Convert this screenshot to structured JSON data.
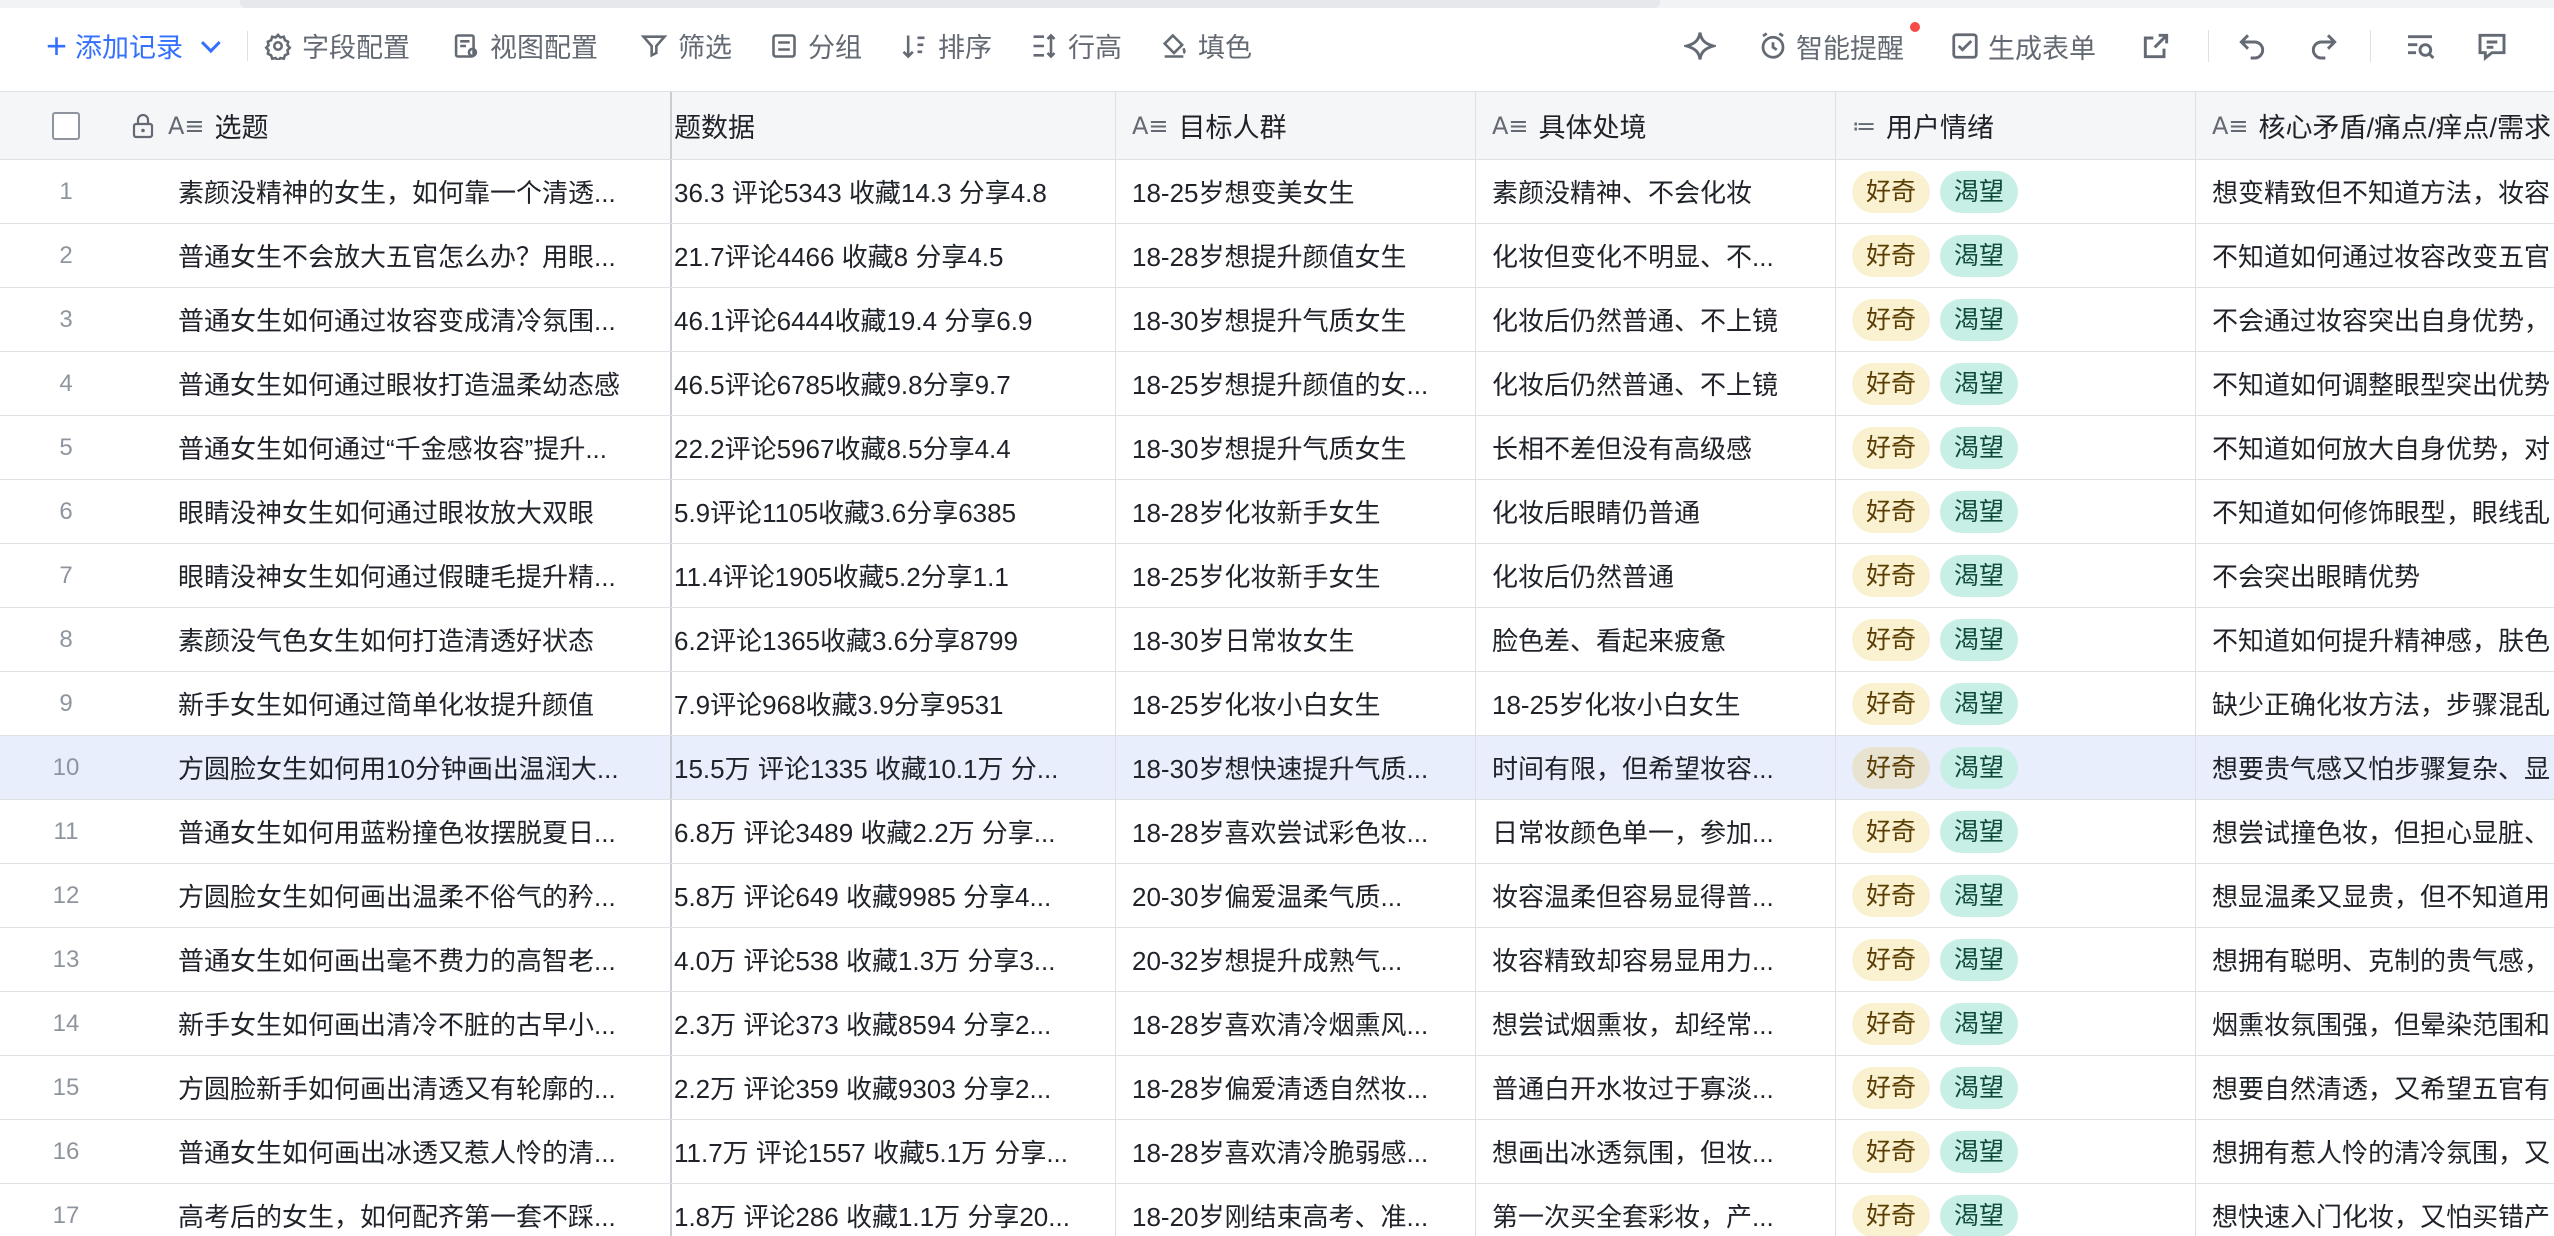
{
  "toolbar": {
    "add_label": "添加记录",
    "items": [
      {
        "label": "字段配置",
        "icon": "gear-icon"
      },
      {
        "label": "视图配置",
        "icon": "view-config-icon"
      },
      {
        "label": "筛选",
        "icon": "filter-icon"
      },
      {
        "label": "分组",
        "icon": "group-icon"
      },
      {
        "label": "排序",
        "icon": "sort-icon"
      },
      {
        "label": "行高",
        "icon": "row-height-icon"
      },
      {
        "label": "填色",
        "icon": "fill-color-icon"
      }
    ],
    "smart_remind_label": "智能提醒",
    "generate_form_label": "生成表单"
  },
  "columns": {
    "title": "选题",
    "data": "题数据",
    "audience": "目标人群",
    "situation": "具体处境",
    "emotion": "用户情绪",
    "core": "核心矛盾/痛点/痒点/需求"
  },
  "emotion_tags": [
    "好奇",
    "渴望"
  ],
  "selected_row": 10,
  "rows": [
    {
      "n": "1",
      "title": "素颜没精神的女生，如何靠一个清透...",
      "data": "36.3 评论5343 收藏14.3 分享4.8",
      "audience": "18-25岁想变美女生",
      "situation": "素颜没精神、不会化妆",
      "core": "想变精致但不知道方法，妆容"
    },
    {
      "n": "2",
      "title": "普通女生不会放大五官怎么办？用眼...",
      "data": "21.7评论4466 收藏8 分享4.5",
      "audience": "18-28岁想提升颜值女生",
      "situation": "化妆但变化不明显、不...",
      "core": "不知道如何通过妆容改变五官"
    },
    {
      "n": "3",
      "title": "普通女生如何通过妆容变成清冷氛围...",
      "data": "46.1评论6444收藏19.4 分享6.9",
      "audience": "18-30岁想提升气质女生",
      "situation": "化妆后仍然普通、不上镜",
      "core": "不会通过妆容突出自身优势，"
    },
    {
      "n": "4",
      "title": "普通女生如何通过眼妆打造温柔幼态感",
      "data": "46.5评论6785收藏9.8分享9.7",
      "audience": "18-25岁想提升颜值的女...",
      "situation": "化妆后仍然普通、不上镜",
      "core": "不知道如何调整眼型突出优势"
    },
    {
      "n": "5",
      "title": "普通女生如何通过“千金感妆容”提升...",
      "data": "22.2评论5967收藏8.5分享4.4",
      "audience": "18-30岁想提升气质女生",
      "situation": "长相不差但没有高级感",
      "core": "不知道如何放大自身优势，对"
    },
    {
      "n": "6",
      "title": "眼睛没神女生如何通过眼妆放大双眼",
      "data": "5.9评论1105收藏3.6分享6385",
      "audience": "18-28岁化妆新手女生",
      "situation": "化妆后眼睛仍普通",
      "core": "不知道如何修饰眼型，眼线乱"
    },
    {
      "n": "7",
      "title": "眼睛没神女生如何通过假睫毛提升精...",
      "data": "11.4评论1905收藏5.2分享1.1",
      "audience": "18-25岁化妆新手女生",
      "situation": "化妆后仍然普通",
      "core": "不会突出眼睛优势"
    },
    {
      "n": "8",
      "title": "素颜没气色女生如何打造清透好状态",
      "data": "6.2评论1365收藏3.6分享8799",
      "audience": "18-30岁日常妆女生",
      "situation": "脸色差、看起来疲惫",
      "core": "不知道如何提升精神感，肤色"
    },
    {
      "n": "9",
      "title": "新手女生如何通过简单化妆提升颜值",
      "data": "7.9评论968收藏3.9分享9531",
      "audience": "18-25岁化妆小白女生",
      "situation": "18-25岁化妆小白女生",
      "core": "缺少正确化妆方法，步骤混乱"
    },
    {
      "n": "10",
      "title": "方圆脸女生如何用10分钟画出温润大...",
      "data": "15.5万 评论1335 收藏10.1万 分...",
      "audience": "18-30岁想快速提升气质...",
      "situation": "时间有限，但希望妆容...",
      "core": "想要贵气感又怕步骤复杂、显"
    },
    {
      "n": "11",
      "title": "普通女生如何用蓝粉撞色妆摆脱夏日...",
      "data": "6.8万 评论3489 收藏2.2万 分享...",
      "audience": "18-28岁喜欢尝试彩色妆...",
      "situation": "日常妆颜色单一，参加...",
      "core": "想尝试撞色妆，但担心显脏、"
    },
    {
      "n": "12",
      "title": "方圆脸女生如何画出温柔不俗气的矜...",
      "data": "5.8万 评论649 收藏9985 分享4...",
      "audience": "20-30岁偏爱温柔气质...",
      "situation": "妆容温柔但容易显得普...",
      "core": "想显温柔又显贵，但不知道用"
    },
    {
      "n": "13",
      "title": "普通女生如何画出毫不费力的高智老...",
      "data": "4.0万 评论538 收藏1.3万 分享3...",
      "audience": "20-32岁想提升成熟气...",
      "situation": "妆容精致却容易显用力...",
      "core": "想拥有聪明、克制的贵气感，"
    },
    {
      "n": "14",
      "title": "新手女生如何画出清冷不脏的古早小...",
      "data": "2.3万 评论373 收藏8594 分享2...",
      "audience": "18-28岁喜欢清冷烟熏风...",
      "situation": "想尝试烟熏妆，却经常...",
      "core": "烟熏妆氛围强，但晕染范围和"
    },
    {
      "n": "15",
      "title": "方圆脸新手如何画出清透又有轮廓的...",
      "data": "2.2万 评论359 收藏9303 分享2...",
      "audience": "18-28岁偏爱清透自然妆...",
      "situation": "普通白开水妆过于寡淡...",
      "core": "想要自然清透，又希望五官有"
    },
    {
      "n": "16",
      "title": "普通女生如何画出冰透又惹人怜的清...",
      "data": "11.7万 评论1557 收藏5.1万 分享...",
      "audience": "18-28岁喜欢清冷脆弱感...",
      "situation": "想画出冰透氛围，但妆...",
      "core": "想拥有惹人怜的清冷氛围，又"
    },
    {
      "n": "17",
      "title": "高考后的女生，如何配齐第一套不踩...",
      "data": "1.8万 评论286 收藏1.1万 分享20...",
      "audience": "18-20岁刚结束高考、准...",
      "situation": "第一次买全套彩妆，产...",
      "core": "想快速入门化妆，又怕买错产"
    }
  ]
}
